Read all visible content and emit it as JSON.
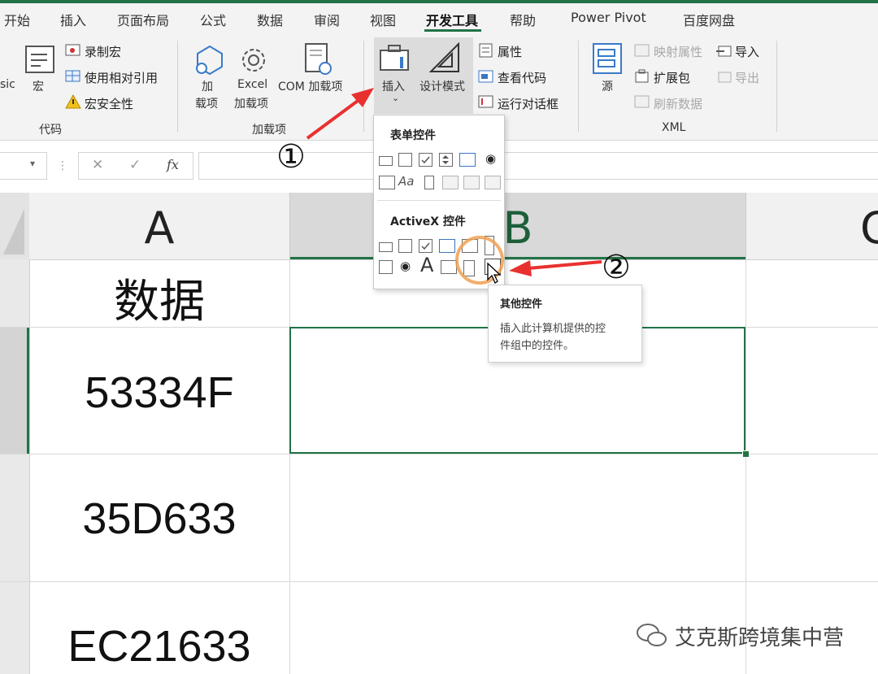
{
  "tabs": [
    {
      "label": "开始"
    },
    {
      "label": "插入"
    },
    {
      "label": "页面布局"
    },
    {
      "label": "公式"
    },
    {
      "label": "数据"
    },
    {
      "label": "审阅"
    },
    {
      "label": "视图"
    },
    {
      "label": "开发工具"
    },
    {
      "label": "帮助"
    },
    {
      "label": "Power Pivot"
    },
    {
      "label": "百度网盘"
    }
  ],
  "active_tab": "开发工具",
  "ribbon": {
    "code": {
      "partial_label": "sic",
      "macro_label": "宏",
      "record_macro": "录制宏",
      "relative_ref": "使用相对引用",
      "macro_security": "宏安全性",
      "group_label": "代码"
    },
    "addins": {
      "addin_label_1": "加",
      "addin_label_2": "载项",
      "excel_addin_1": "Excel",
      "excel_addin_2": "加载项",
      "com_addin": "COM 加载项",
      "group_label": "加载项"
    },
    "controls": {
      "insert_label": "插入",
      "design_mode_label": "设计模式",
      "properties": "属性",
      "view_code": "查看代码",
      "run_dialog": "运行对话框"
    },
    "xml": {
      "source_label": "源",
      "map_properties": "映射属性",
      "expansion_packs": "扩展包",
      "refresh_data": "刷新数据",
      "import": "导入",
      "export": "导出",
      "group_label": "XML"
    }
  },
  "formula_bar": {
    "cancel": "✕",
    "enter": "✓",
    "fx": "fx"
  },
  "columns": [
    "A",
    "B",
    "C"
  ],
  "cells": [
    "数据",
    "53334F",
    "35D633",
    "EC21633"
  ],
  "dropdown": {
    "form_controls_title": "表单控件",
    "activex_title": "ActiveX 控件"
  },
  "tooltip": {
    "title": "其他控件",
    "line1": "插入此计算机提供的控",
    "line2": "件组中的控件。"
  },
  "annotations": {
    "step1": "①",
    "step2": "②"
  },
  "watermark": "艾克斯跨境集中营",
  "colors": {
    "excel_green": "#217346",
    "arrow_red": "#e8312f",
    "highlight_orange": "#f0a050"
  }
}
